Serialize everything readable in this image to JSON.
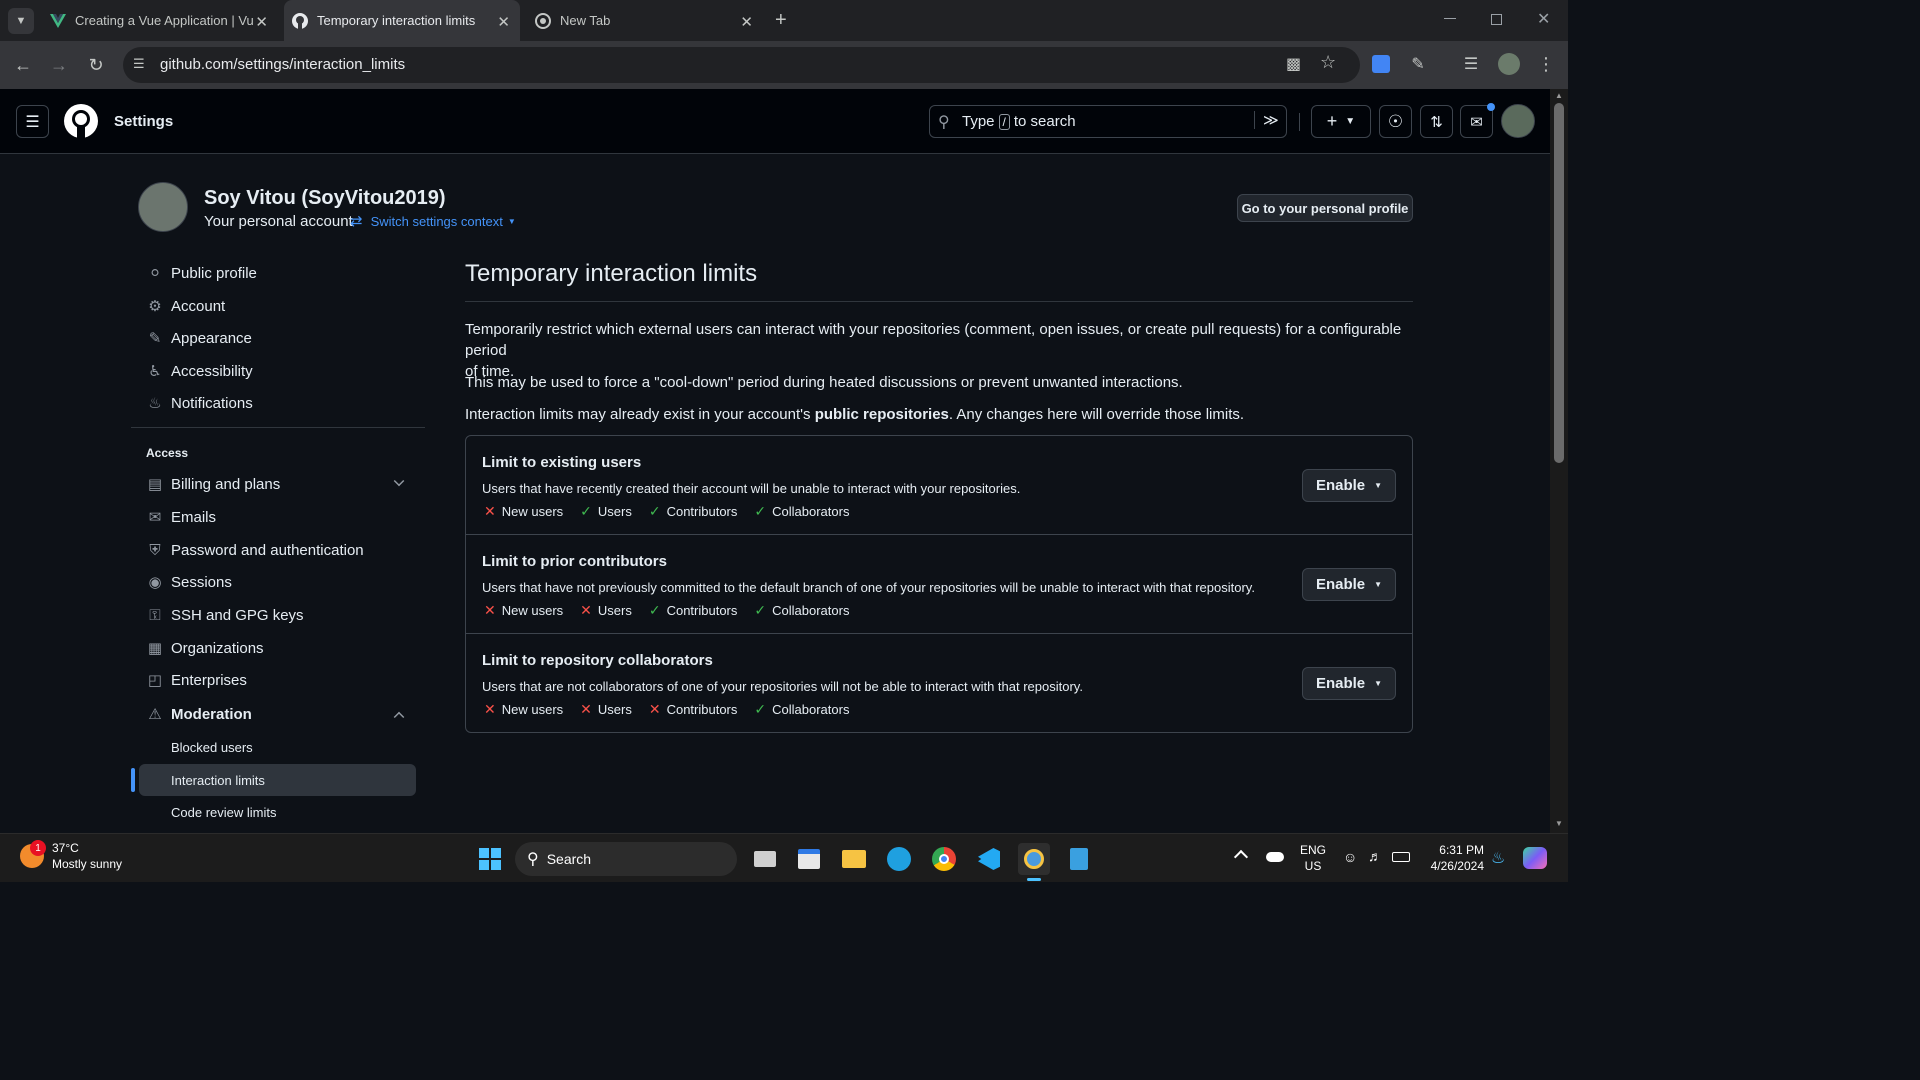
{
  "browser": {
    "tabs": [
      {
        "title": "Creating a Vue Application | Vu",
        "favicon": "vue-logo-icon"
      },
      {
        "title": "Temporary interaction limits",
        "favicon": "github-icon"
      },
      {
        "title": "New Tab",
        "favicon": "chrome-icon"
      }
    ],
    "url": "github.com/settings/interaction_limits"
  },
  "header": {
    "title": "Settings",
    "search_placeholder_pre": "Type",
    "search_key": "/",
    "search_placeholder_post": "to search"
  },
  "profile": {
    "name": "Soy Vitou (SoyVitou2019)",
    "subtitle": "Your personal account",
    "switch_label": "Switch settings context",
    "go_profile_label": "Go to your personal profile"
  },
  "sidebar": {
    "items": [
      {
        "label": "Public profile",
        "icon": "person-icon"
      },
      {
        "label": "Account",
        "icon": "gear-icon"
      },
      {
        "label": "Appearance",
        "icon": "paintbrush-icon"
      },
      {
        "label": "Accessibility",
        "icon": "accessibility-icon"
      },
      {
        "label": "Notifications",
        "icon": "bell-icon"
      }
    ],
    "access_heading": "Access",
    "access_items": [
      {
        "label": "Billing and plans",
        "icon": "credit-card-icon"
      },
      {
        "label": "Emails",
        "icon": "mail-icon"
      },
      {
        "label": "Password and authentication",
        "icon": "shield-lock-icon"
      },
      {
        "label": "Sessions",
        "icon": "broadcast-icon"
      },
      {
        "label": "SSH and GPG keys",
        "icon": "key-icon"
      },
      {
        "label": "Organizations",
        "icon": "organization-icon"
      },
      {
        "label": "Enterprises",
        "icon": "globe-icon"
      }
    ],
    "moderation": {
      "label": "Moderation",
      "sub": [
        "Blocked users",
        "Interaction limits",
        "Code review limits"
      ],
      "selected": "Interaction limits"
    }
  },
  "main": {
    "title": "Temporary interaction limits",
    "intro_1": "Temporarily restrict which external users can interact with your repositories (comment, open issues, or create pull requests) for a configurable period",
    "intro_1b": "of time.",
    "intro_2": "This may be used to force a \"cool-down\" period during heated discussions or prevent unwanted interactions.",
    "intro_3_pre": "Interaction limits may already exist in your account's",
    "intro_3_bold": "public repositories",
    "intro_3_post": ". Any changes here will override those limits.",
    "options": [
      {
        "title": "Limit to existing users",
        "desc": "Users that have recently created their account will be unable to interact with your repositories.",
        "checks": [
          {
            "label": "New users",
            "allowed": false
          },
          {
            "label": "Users",
            "allowed": true
          },
          {
            "label": "Contributors",
            "allowed": true
          },
          {
            "label": "Collaborators",
            "allowed": true
          }
        ],
        "button": "Enable"
      },
      {
        "title": "Limit to prior contributors",
        "desc": "Users that have not previously committed to the default branch of one of your repositories will be unable to interact with that repository.",
        "checks": [
          {
            "label": "New users",
            "allowed": false
          },
          {
            "label": "Users",
            "allowed": false
          },
          {
            "label": "Contributors",
            "allowed": true
          },
          {
            "label": "Collaborators",
            "allowed": true
          }
        ],
        "button": "Enable"
      },
      {
        "title": "Limit to repository collaborators",
        "desc": "Users that are not collaborators of one of your repositories will not be able to interact with that repository.",
        "checks": [
          {
            "label": "New users",
            "allowed": false
          },
          {
            "label": "Users",
            "allowed": false
          },
          {
            "label": "Contributors",
            "allowed": false
          },
          {
            "label": "Collaborators",
            "allowed": true
          }
        ],
        "button": "Enable"
      }
    ]
  },
  "taskbar": {
    "weather_temp": "37°C",
    "weather_desc": "Mostly sunny",
    "weather_badge": "1",
    "search_label": "Search",
    "lang_1": "ENG",
    "lang_2": "US",
    "time": "6:31 PM",
    "date": "4/26/2024"
  },
  "colors": {
    "accent": "#4493f8",
    "danger": "#f85149",
    "success": "#3fb950",
    "selected_bg": "#2f353d"
  }
}
